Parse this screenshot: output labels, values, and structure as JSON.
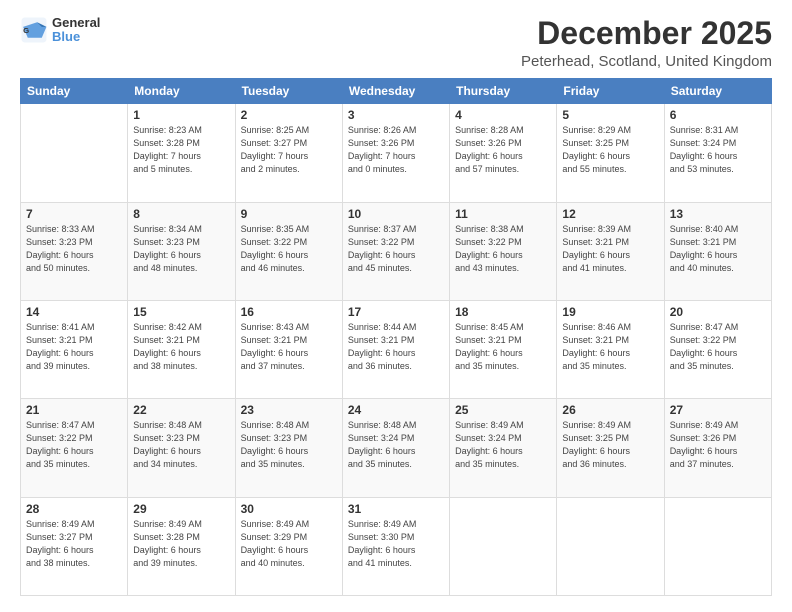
{
  "logo": {
    "line1": "General",
    "line2": "Blue"
  },
  "title": "December 2025",
  "subtitle": "Peterhead, Scotland, United Kingdom",
  "headers": [
    "Sunday",
    "Monday",
    "Tuesday",
    "Wednesday",
    "Thursday",
    "Friday",
    "Saturday"
  ],
  "weeks": [
    [
      {
        "day": "",
        "info": ""
      },
      {
        "day": "1",
        "info": "Sunrise: 8:23 AM\nSunset: 3:28 PM\nDaylight: 7 hours\nand 5 minutes."
      },
      {
        "day": "2",
        "info": "Sunrise: 8:25 AM\nSunset: 3:27 PM\nDaylight: 7 hours\nand 2 minutes."
      },
      {
        "day": "3",
        "info": "Sunrise: 8:26 AM\nSunset: 3:26 PM\nDaylight: 7 hours\nand 0 minutes."
      },
      {
        "day": "4",
        "info": "Sunrise: 8:28 AM\nSunset: 3:26 PM\nDaylight: 6 hours\nand 57 minutes."
      },
      {
        "day": "5",
        "info": "Sunrise: 8:29 AM\nSunset: 3:25 PM\nDaylight: 6 hours\nand 55 minutes."
      },
      {
        "day": "6",
        "info": "Sunrise: 8:31 AM\nSunset: 3:24 PM\nDaylight: 6 hours\nand 53 minutes."
      }
    ],
    [
      {
        "day": "7",
        "info": "Sunrise: 8:33 AM\nSunset: 3:23 PM\nDaylight: 6 hours\nand 50 minutes."
      },
      {
        "day": "8",
        "info": "Sunrise: 8:34 AM\nSunset: 3:23 PM\nDaylight: 6 hours\nand 48 minutes."
      },
      {
        "day": "9",
        "info": "Sunrise: 8:35 AM\nSunset: 3:22 PM\nDaylight: 6 hours\nand 46 minutes."
      },
      {
        "day": "10",
        "info": "Sunrise: 8:37 AM\nSunset: 3:22 PM\nDaylight: 6 hours\nand 45 minutes."
      },
      {
        "day": "11",
        "info": "Sunrise: 8:38 AM\nSunset: 3:22 PM\nDaylight: 6 hours\nand 43 minutes."
      },
      {
        "day": "12",
        "info": "Sunrise: 8:39 AM\nSunset: 3:21 PM\nDaylight: 6 hours\nand 41 minutes."
      },
      {
        "day": "13",
        "info": "Sunrise: 8:40 AM\nSunset: 3:21 PM\nDaylight: 6 hours\nand 40 minutes."
      }
    ],
    [
      {
        "day": "14",
        "info": "Sunrise: 8:41 AM\nSunset: 3:21 PM\nDaylight: 6 hours\nand 39 minutes."
      },
      {
        "day": "15",
        "info": "Sunrise: 8:42 AM\nSunset: 3:21 PM\nDaylight: 6 hours\nand 38 minutes."
      },
      {
        "day": "16",
        "info": "Sunrise: 8:43 AM\nSunset: 3:21 PM\nDaylight: 6 hours\nand 37 minutes."
      },
      {
        "day": "17",
        "info": "Sunrise: 8:44 AM\nSunset: 3:21 PM\nDaylight: 6 hours\nand 36 minutes."
      },
      {
        "day": "18",
        "info": "Sunrise: 8:45 AM\nSunset: 3:21 PM\nDaylight: 6 hours\nand 35 minutes."
      },
      {
        "day": "19",
        "info": "Sunrise: 8:46 AM\nSunset: 3:21 PM\nDaylight: 6 hours\nand 35 minutes."
      },
      {
        "day": "20",
        "info": "Sunrise: 8:47 AM\nSunset: 3:22 PM\nDaylight: 6 hours\nand 35 minutes."
      }
    ],
    [
      {
        "day": "21",
        "info": "Sunrise: 8:47 AM\nSunset: 3:22 PM\nDaylight: 6 hours\nand 35 minutes."
      },
      {
        "day": "22",
        "info": "Sunrise: 8:48 AM\nSunset: 3:23 PM\nDaylight: 6 hours\nand 34 minutes."
      },
      {
        "day": "23",
        "info": "Sunrise: 8:48 AM\nSunset: 3:23 PM\nDaylight: 6 hours\nand 35 minutes."
      },
      {
        "day": "24",
        "info": "Sunrise: 8:48 AM\nSunset: 3:24 PM\nDaylight: 6 hours\nand 35 minutes."
      },
      {
        "day": "25",
        "info": "Sunrise: 8:49 AM\nSunset: 3:24 PM\nDaylight: 6 hours\nand 35 minutes."
      },
      {
        "day": "26",
        "info": "Sunrise: 8:49 AM\nSunset: 3:25 PM\nDaylight: 6 hours\nand 36 minutes."
      },
      {
        "day": "27",
        "info": "Sunrise: 8:49 AM\nSunset: 3:26 PM\nDaylight: 6 hours\nand 37 minutes."
      }
    ],
    [
      {
        "day": "28",
        "info": "Sunrise: 8:49 AM\nSunset: 3:27 PM\nDaylight: 6 hours\nand 38 minutes."
      },
      {
        "day": "29",
        "info": "Sunrise: 8:49 AM\nSunset: 3:28 PM\nDaylight: 6 hours\nand 39 minutes."
      },
      {
        "day": "30",
        "info": "Sunrise: 8:49 AM\nSunset: 3:29 PM\nDaylight: 6 hours\nand 40 minutes."
      },
      {
        "day": "31",
        "info": "Sunrise: 8:49 AM\nSunset: 3:30 PM\nDaylight: 6 hours\nand 41 minutes."
      },
      {
        "day": "",
        "info": ""
      },
      {
        "day": "",
        "info": ""
      },
      {
        "day": "",
        "info": ""
      }
    ]
  ]
}
